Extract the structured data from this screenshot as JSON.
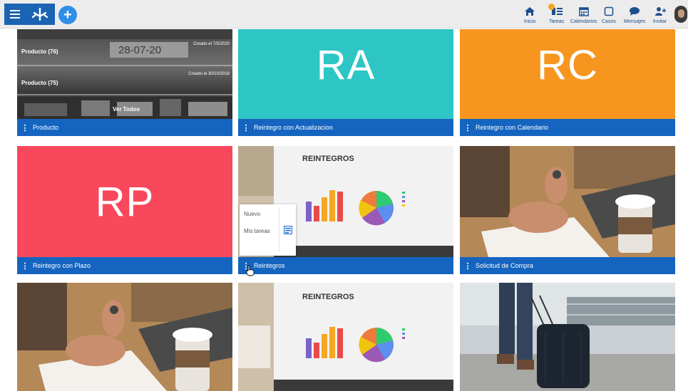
{
  "topbar": {
    "nav": [
      {
        "label": "Inicio",
        "icon": "home-icon"
      },
      {
        "label": "Tareas",
        "icon": "tasks-icon"
      },
      {
        "label": "Calendarios",
        "icon": "calendar-icon"
      },
      {
        "label": "Casos",
        "icon": "cases-icon"
      },
      {
        "label": "Mensajes",
        "icon": "messages-icon"
      },
      {
        "label": "Invitar",
        "icon": "invite-icon"
      }
    ]
  },
  "cards": {
    "producto": {
      "title": "Producto",
      "rows": [
        {
          "label": "Producto (76)",
          "created": "Creado el 7/5/2020",
          "date_stamp": "28-07-20"
        },
        {
          "label": "Producto (75)",
          "created": "Creado el 30/10/2018"
        }
      ],
      "ver_todos": "Ver Todos"
    },
    "ra": {
      "letters": "RA",
      "title": "Reintegro con Actualizacion",
      "color": "#2ec5c5"
    },
    "rc": {
      "letters": "RC",
      "title": "Reintegro con Calendario",
      "color": "#f7961e"
    },
    "rp": {
      "letters": "RP",
      "title": "Reintegro con Plazo",
      "color": "#f9485c"
    },
    "reintegros": {
      "title": "Reintegros",
      "image_heading": "REINTEGROS"
    },
    "solicitud": {
      "title": "Solicitud de Compra"
    },
    "bottom_middle": {
      "image_heading": "REINTEGROS"
    }
  },
  "popup_menu": {
    "items": [
      "Nuevo",
      "Mis tareas"
    ]
  },
  "colors": {
    "bar": "#1565c0",
    "brand": "#1b63b3"
  }
}
